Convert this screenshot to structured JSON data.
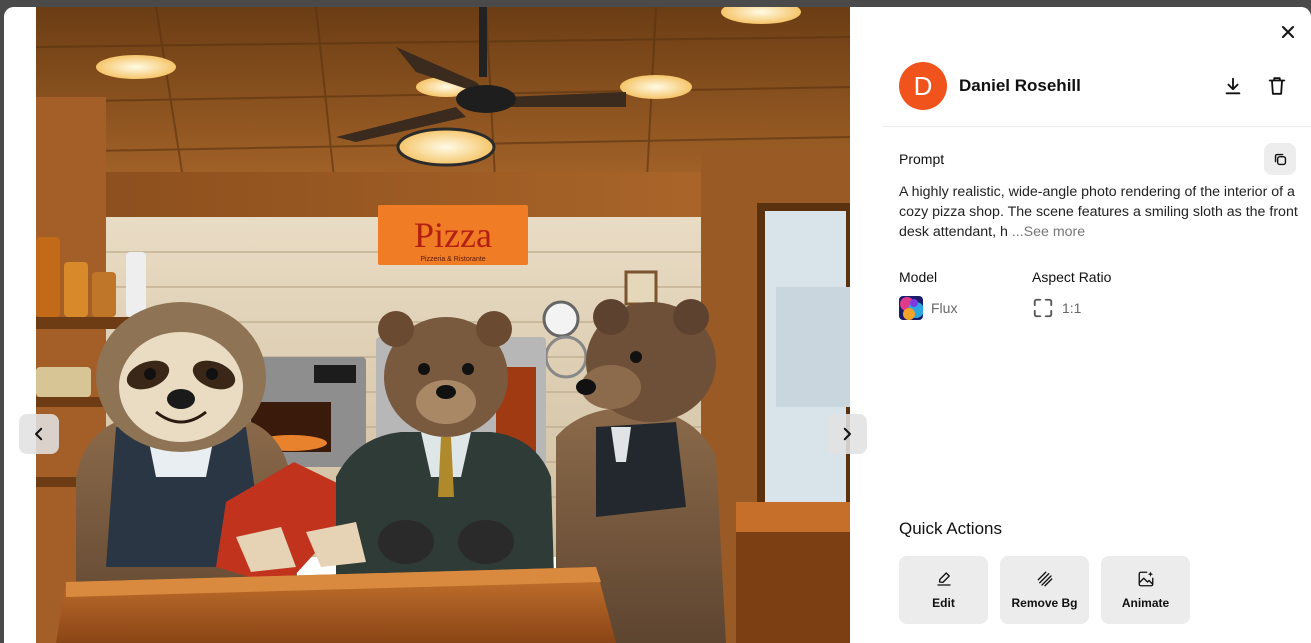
{
  "author": {
    "initial": "D",
    "name": "Daniel Rosehill",
    "avatar_color": "#f0531c"
  },
  "prompt": {
    "label": "Prompt",
    "text": "A highly realistic, wide-angle photo rendering of the interior of a cozy pizza shop. The scene features a smiling sloth as the front desk attendant, h",
    "see_more": "...See more"
  },
  "meta": {
    "model_label": "Model",
    "model_value": "Flux",
    "aspect_label": "Aspect Ratio",
    "aspect_value": "1:1"
  },
  "image": {
    "sign_text": "Pizza",
    "sign_subtext": "Pizzeria & Ristorante"
  },
  "quick_actions": {
    "title": "Quick Actions",
    "items": [
      {
        "label": "Edit",
        "icon": "pencil-icon"
      },
      {
        "label": "Remove Bg",
        "icon": "remove-background-icon"
      },
      {
        "label": "Animate",
        "icon": "animate-image-icon"
      }
    ]
  },
  "icons": {
    "close": "close-icon",
    "download": "download-icon",
    "delete": "trash-icon",
    "copy": "copy-icon",
    "prev": "chevron-left-icon",
    "next": "chevron-right-icon"
  }
}
